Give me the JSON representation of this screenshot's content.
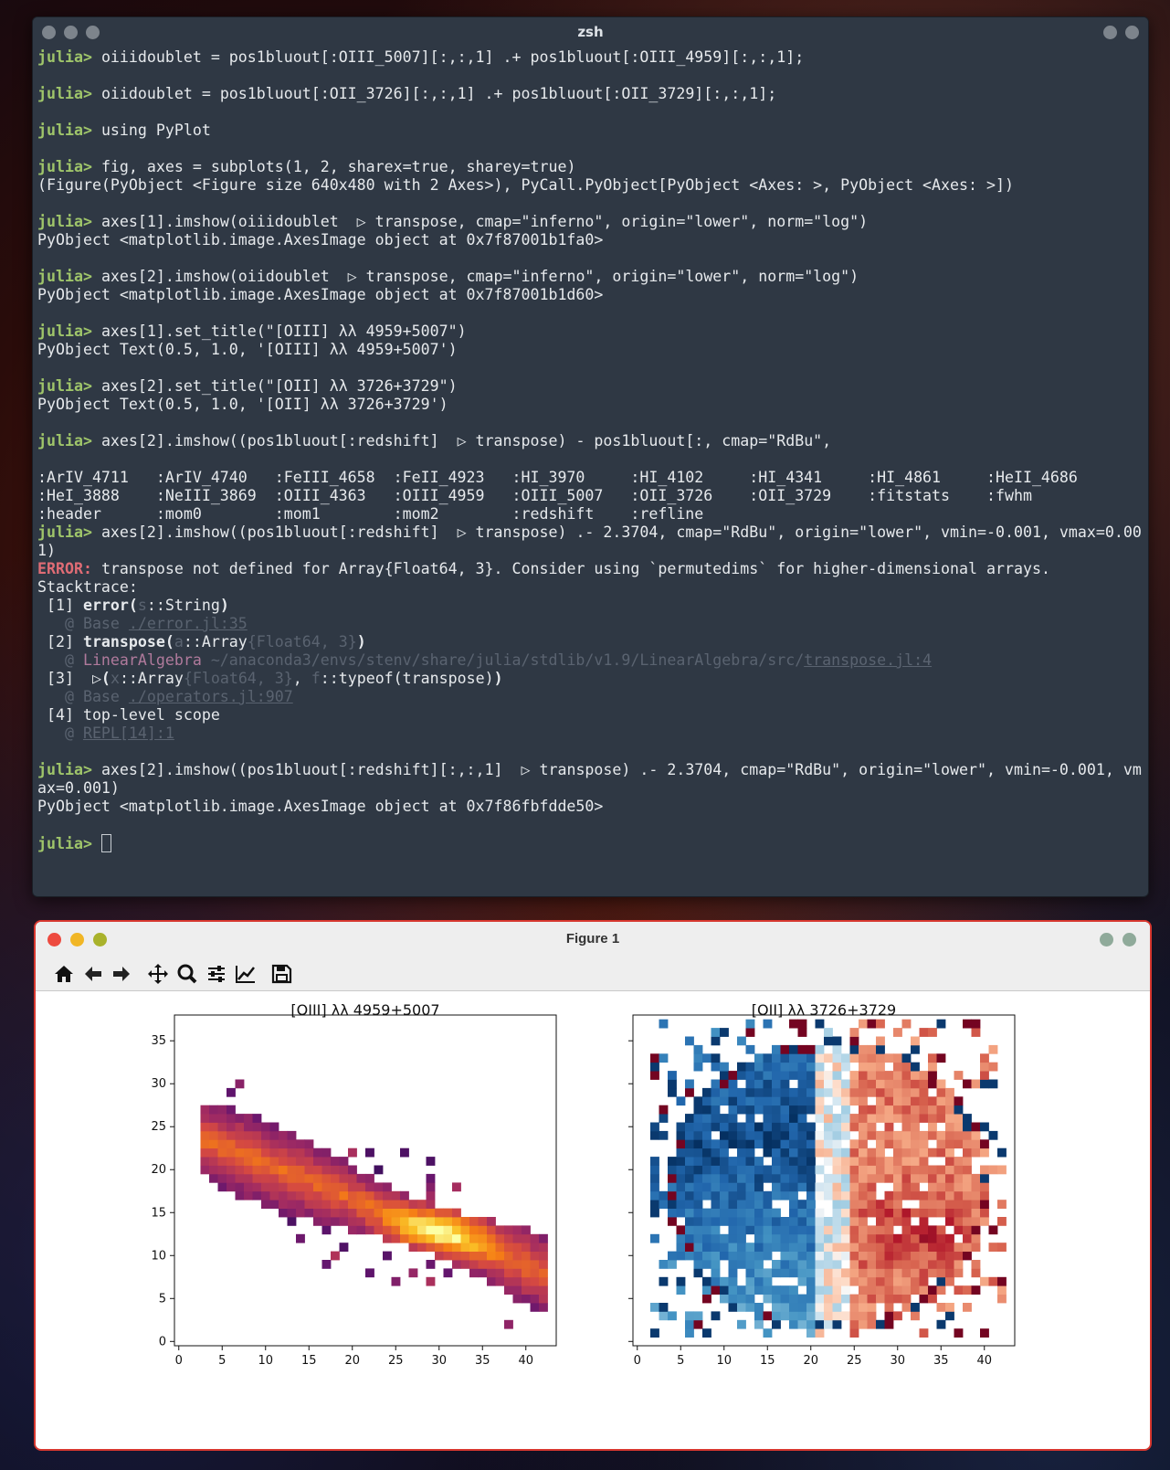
{
  "terminal": {
    "title": "zsh",
    "prompt": "julia>",
    "lines": [
      {
        "kind": "cmd",
        "text": " oiiidoublet = pos1bluout[:OIII_5007][:,:,1] .+ pos1bluout[:OIII_4959][:,:,1];"
      },
      {
        "kind": "blank"
      },
      {
        "kind": "cmd",
        "text": " oiidoublet = pos1bluout[:OII_3726][:,:,1] .+ pos1bluout[:OII_3729][:,:,1];"
      },
      {
        "kind": "blank"
      },
      {
        "kind": "cmd",
        "text": " using PyPlot"
      },
      {
        "kind": "blank"
      },
      {
        "kind": "cmd",
        "text": " fig, axes = subplots(1, 2, sharex=true, sharey=true)"
      },
      {
        "kind": "out",
        "text": "(Figure(PyObject <Figure size 640x480 with 2 Axes>), PyCall.PyObject[PyObject <Axes: >, PyObject <Axes: >])"
      },
      {
        "kind": "blank"
      },
      {
        "kind": "cmd",
        "text": " axes[1].imshow(oiiidoublet  ▷ transpose, cmap=\"inferno\", origin=\"lower\", norm=\"log\")"
      },
      {
        "kind": "out",
        "text": "PyObject <matplotlib.image.AxesImage object at 0x7f87001b1fa0>"
      },
      {
        "kind": "blank"
      },
      {
        "kind": "cmd",
        "text": " axes[2].imshow(oiidoublet  ▷ transpose, cmap=\"inferno\", origin=\"lower\", norm=\"log\")"
      },
      {
        "kind": "out",
        "text": "PyObject <matplotlib.image.AxesImage object at 0x7f87001b1d60>"
      },
      {
        "kind": "blank"
      },
      {
        "kind": "cmd",
        "text": " axes[1].set_title(\"[OIII] λλ 4959+5007\")"
      },
      {
        "kind": "out",
        "text": "PyObject Text(0.5, 1.0, '[OIII] λλ 4959+5007')"
      },
      {
        "kind": "blank"
      },
      {
        "kind": "cmd",
        "text": " axes[2].set_title(\"[OII] λλ 3726+3729\")"
      },
      {
        "kind": "out",
        "text": "PyObject Text(0.5, 1.0, '[OII] λλ 3726+3729')"
      },
      {
        "kind": "blank"
      },
      {
        "kind": "cmd",
        "text": " axes[2].imshow((pos1bluout[:redshift]  ▷ transpose) - pos1bluout[:, cmap=\"RdBu\","
      },
      {
        "kind": "blank"
      },
      {
        "kind": "out",
        "text": ":ArIV_4711   :ArIV_4740   :FeIII_4658  :FeII_4923   :HI_3970     :HI_4102     :HI_4341     :HI_4861     :HeII_4686"
      },
      {
        "kind": "out",
        "text": ":HeI_3888    :NeIII_3869  :OIII_4363   :OIII_4959   :OIII_5007   :OII_3726    :OII_3729    :fitstats    :fwhm"
      },
      {
        "kind": "out",
        "text": ":header      :mom0        :mom1        :mom2        :redshift    :refline"
      },
      {
        "kind": "cmd",
        "text": " axes[2].imshow((pos1bluout[:redshift]  ▷ transpose) .- 2.3704, cmap=\"RdBu\", origin=\"lower\", vmin=-0.001, vmax=0.00"
      },
      {
        "kind": "out",
        "text": "1)"
      },
      {
        "kind": "error",
        "label": "ERROR:",
        "text": " transpose not defined for Array{Float64, 3}. Consider using `permutedims` for higher-dimensional arrays."
      },
      {
        "kind": "out",
        "text": "Stacktrace:"
      },
      {
        "kind": "st1",
        "num": " [1] ",
        "fn": "error(",
        "arg": "s",
        "type": "::String",
        "close": ")"
      },
      {
        "kind": "loc",
        "at": "   @ Base ",
        "file": "./error.jl:35"
      },
      {
        "kind": "st2",
        "num": " [2] ",
        "fn": "transpose(",
        "arg": "a",
        "type": "::Array",
        "param": "{Float64, 3}",
        "close": ")"
      },
      {
        "kind": "loc2",
        "at": "   @ ",
        "mod": "LinearAlgebra",
        "path": " ~/anaconda3/envs/stenv/share/julia/stdlib/v1.9/LinearAlgebra/src/",
        "file": "transpose.jl:4"
      },
      {
        "kind": "st3",
        "num": " [3] ",
        "fn": " ▷(",
        "a1": "x",
        "t1": "::Array",
        "p1": "{Float64, 3}",
        "sep": ", ",
        "a2": "f",
        "t2": "::typeof(transpose)",
        "close": ")"
      },
      {
        "kind": "loc",
        "at": "   @ Base ",
        "file": "./operators.jl:907"
      },
      {
        "kind": "out",
        "text": " [4] top-level scope"
      },
      {
        "kind": "loc",
        "at": "   @ ",
        "file": "REPL[14]:1"
      },
      {
        "kind": "blank"
      },
      {
        "kind": "cmd",
        "text": " axes[2].imshow((pos1bluout[:redshift][:,:,1]  ▷ transpose) .- 2.3704, cmap=\"RdBu\", origin=\"lower\", vmin=-0.001, vm"
      },
      {
        "kind": "out",
        "text": "ax=0.001)"
      },
      {
        "kind": "out",
        "text": "PyObject <matplotlib.image.AxesImage object at 0x7f86fbfdde50>"
      },
      {
        "kind": "blank"
      },
      {
        "kind": "promptonly"
      }
    ]
  },
  "figure": {
    "title": "Figure 1",
    "toolbar": [
      "home-icon",
      "back-icon",
      "forward-icon",
      "pan-icon",
      "zoom-icon",
      "configure-icon",
      "edit-axis-icon",
      "save-icon"
    ],
    "close_color": "#ed4a3f",
    "min_color": "#f1b625",
    "max_color": "#a9b22b"
  },
  "chart_data": [
    {
      "type": "heatmap",
      "title": "[OIII] λλ 4959+5007",
      "colormap": "inferno",
      "norm": "log",
      "xlim": [
        0,
        44
      ],
      "ylim": [
        0,
        38
      ],
      "xticks": [
        0,
        5,
        10,
        15,
        20,
        25,
        30,
        35,
        40
      ],
      "yticks": [
        0,
        5,
        10,
        15,
        20,
        25,
        30,
        35
      ],
      "description_of_data": "diagonal band of emission from upper-left (x~3,y~23) to lower-right (x~42,y~8); peak near x=28-36, y=11-15"
    },
    {
      "type": "heatmap",
      "title": "[OII] λλ 3726+3729",
      "colormap": "RdBu",
      "vmin": -0.001,
      "vmax": 0.001,
      "xlim": [
        0,
        44
      ],
      "ylim": [
        0,
        38
      ],
      "xticks": [
        0,
        5,
        10,
        15,
        20,
        25,
        30,
        35,
        40
      ],
      "yticks": [
        0,
        5,
        10,
        15,
        20,
        25,
        30,
        35
      ],
      "description_of_data": "velocity map: blue (negative) on left side x<22, red (positive) on right side x>24"
    }
  ]
}
